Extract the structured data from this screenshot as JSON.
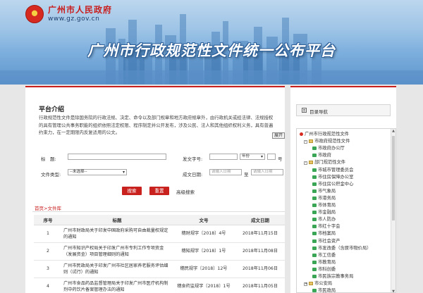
{
  "header": {
    "gov_name": "广州市人民政府",
    "gov_url": "www.gz.gov.cn",
    "banner_title": "广州市行政规范性文件统一公布平台"
  },
  "intro": {
    "title": "平台介绍",
    "text": "行政规范性文件是除国务院的行政法规、决定、命令以及部门规章和地方政府规章外，由行政机关或经法律、法规授权的具有管理公共事务职能的组织依照法定权限、程序制定并公开发布，涉及公民、法人和其他组织权利义务，具有普遍约束力，在一定期限内反复适用的公文。",
    "expand_label": "展开"
  },
  "search": {
    "title_label": "标　题:",
    "doc_num_label": "发文字号:",
    "year_placeholder": "年份",
    "num_suffix": "号",
    "type_label": "文件类型:",
    "type_selected": "--未选择--",
    "date_label": "成文日期:",
    "date_start_placeholder": "请输入日期",
    "date_sep": "至",
    "date_end_placeholder": "请输入日期",
    "search_button": "搜索",
    "reset_button": "重置",
    "advanced_link": "高级搜索"
  },
  "breadcrumb": "首页>文件库",
  "table": {
    "headers": [
      "序号",
      "标题",
      "文号",
      "成文日期"
    ],
    "rows": [
      {
        "no": "1",
        "title": "广州市财政局关于印发中国政府采购可自由裁量权规定的通知",
        "num": "穗财规字〔2018〕4号",
        "date": "2018年11月15日"
      },
      {
        "no": "2",
        "title": "广州市知识产权局关于印发广州市专利工作专项资金（发展资金）项目管理细则的通知",
        "num": "穗知规字〔2018〕1号",
        "date": "2018年11月08日"
      },
      {
        "no": "3",
        "title": "广州市民政局关于印发广州市社区居家养老服务评估细则（试行）的通知",
        "num": "穗民规字〔2018〕12号",
        "date": "2018年11月06日"
      },
      {
        "no": "4",
        "title": "广州市食品药品监督管理局关于印发广州市医疗机构制剂中药饮片备案管理办法的通知",
        "num": "穗食药监规字〔2018〕1号",
        "date": "2018年11月05日"
      }
    ]
  },
  "sidebar": {
    "nav_title": "目录导航",
    "tree": [
      {
        "label": "广州市行政规范性文件",
        "level": 0,
        "icon": "flag-icon",
        "toggle": ""
      },
      {
        "label": "市政府规范性文件",
        "level": 1,
        "icon": "folder-icon",
        "toggle": "-"
      },
      {
        "label": "市政府办公厅",
        "level": 2,
        "icon": "green-icon",
        "toggle": ""
      },
      {
        "label": "市政府",
        "level": 2,
        "icon": "green-icon",
        "toggle": ""
      },
      {
        "label": "部门规范性文件",
        "level": 1,
        "icon": "folder-icon",
        "toggle": "-"
      },
      {
        "label": "市城市管理委员会",
        "level": 2,
        "icon": "green-icon",
        "toggle": ""
      },
      {
        "label": "市住房保障办公室",
        "level": 2,
        "icon": "green-icon",
        "toggle": ""
      },
      {
        "label": "市住房公积金中心",
        "level": 2,
        "icon": "green-icon",
        "toggle": ""
      },
      {
        "label": "市气象局",
        "level": 2,
        "icon": "green-icon",
        "toggle": ""
      },
      {
        "label": "市港务局",
        "level": 2,
        "icon": "green-icon",
        "toggle": ""
      },
      {
        "label": "市体育局",
        "level": 2,
        "icon": "green-icon",
        "toggle": ""
      },
      {
        "label": "市金融局",
        "level": 2,
        "icon": "green-icon",
        "toggle": ""
      },
      {
        "label": "市人防办",
        "level": 2,
        "icon": "green-icon",
        "toggle": ""
      },
      {
        "label": "市红十字会",
        "level": 2,
        "icon": "green-icon",
        "toggle": ""
      },
      {
        "label": "市档案局",
        "level": 2,
        "icon": "green-icon",
        "toggle": ""
      },
      {
        "label": "市社会资产",
        "level": 2,
        "icon": "green-icon",
        "toggle": ""
      },
      {
        "label": "市发改委（含原市物价局）",
        "level": 2,
        "icon": "green-icon",
        "toggle": ""
      },
      {
        "label": "市工信委",
        "level": 2,
        "icon": "green-icon",
        "toggle": ""
      },
      {
        "label": "市教育局",
        "level": 2,
        "icon": "green-icon",
        "toggle": ""
      },
      {
        "label": "市科创委",
        "level": 2,
        "icon": "green-icon",
        "toggle": ""
      },
      {
        "label": "市民族宗教事务局",
        "level": 2,
        "icon": "green-icon",
        "toggle": ""
      },
      {
        "label": "市公安局",
        "level": 1,
        "icon": "folder-icon",
        "toggle": "+"
      },
      {
        "label": "市民政局",
        "level": 2,
        "icon": "green-icon",
        "toggle": ""
      }
    ]
  },
  "colors": {
    "accent": "#c81e1e",
    "button": "#c9211e"
  }
}
